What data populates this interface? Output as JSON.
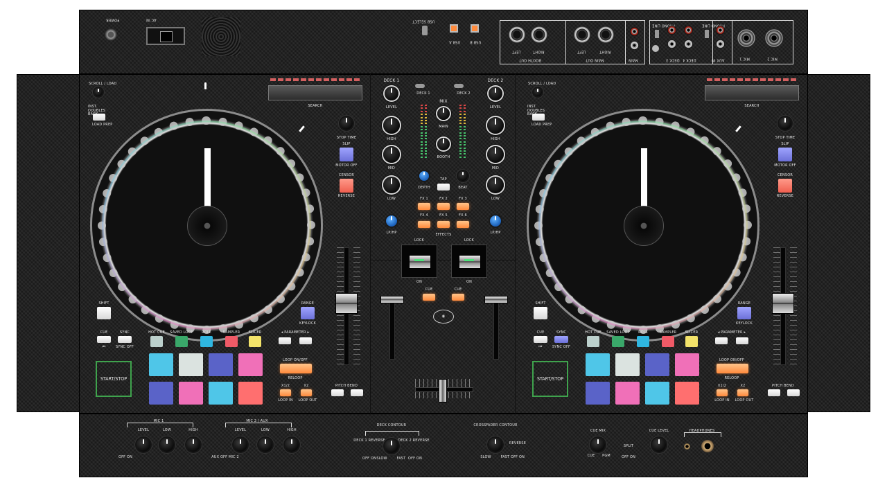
{
  "device": {
    "rear_panel": {
      "power_label": "POWER",
      "ac_label": "AC IN",
      "usb_a_label": "USB A",
      "usb_b_label": "USB B",
      "usb_switch_label": "USB SELECT",
      "booth_out_label": "BOOTH OUT",
      "main_out_label": "MAIN OUT",
      "xlr_left": "LEFT",
      "xlr_right": "RIGHT",
      "main_rca_label": "MAIN",
      "aux_in_label": "AUX IN",
      "deck3_label": "DECK 3",
      "deck4_label": "DECK 4",
      "phono_line_label": "PHONO LINE",
      "mic1_label": "MIC 1",
      "mic2_label": "MIC 2"
    },
    "deck_left": {
      "scroll_label": "SCROLL / LOAD",
      "back_label": "INST. DOUBLES BACK",
      "load_prep_label": "LOAD PREP",
      "search_label": "SEARCH",
      "stop_time_label": "STOP TIME",
      "slip_label": "SLIP",
      "motor_off_label": "MOTOR OFF",
      "censor_label": "CENSOR",
      "reverse_label": "REVERSE",
      "shift_label": "SHIFT",
      "range_label": "RANGE",
      "keylock_label": "KEYLOCK",
      "cue_label": "CUE",
      "sync_label": "SYNC",
      "sync_off_label": "SYNC OFF",
      "start_stop_label": "START/STOP",
      "mode_labels": [
        "HOT CUE",
        "SAVED LOOP",
        "ROLL",
        "SAMPLER",
        "SLICER"
      ],
      "parameter_label": "◂ PARAMETER ▸",
      "loop_on_off_label": "LOOP ON/OFF",
      "reloop_label": "RELOOP",
      "loop_half_label": "x1/2",
      "loop_double_label": "x2",
      "loop_in_label": "LOOP IN",
      "loop_out_label": "LOOP OUT",
      "pitch_bend_label": "PITCH BEND"
    },
    "deck_right": {
      "scroll_label": "SCROLL / LOAD",
      "back_label": "INST. DOUBLES BACK",
      "load_prep_label": "LOAD PREP",
      "search_label": "SEARCH",
      "stop_time_label": "STOP TIME",
      "slip_label": "SLIP",
      "motor_off_label": "MOTOR OFF",
      "censor_label": "CENSOR",
      "reverse_label": "REVERSE",
      "shift_label": "SHIFT",
      "range_label": "RANGE",
      "keylock_label": "KEYLOCK",
      "cue_label": "CUE",
      "sync_label": "SYNC",
      "sync_off_label": "SYNC OFF",
      "start_stop_label": "START/STOP",
      "mode_labels": [
        "HOT CUE",
        "SAVED LOOP",
        "ROLL",
        "SAMPLER",
        "SLICER"
      ],
      "parameter_label": "◂ PARAMETER ▸",
      "loop_on_off_label": "LOOP ON/OFF",
      "reloop_label": "RELOOP",
      "loop_half_label": "x1/2",
      "loop_double_label": "x2",
      "loop_in_label": "LOOP IN",
      "loop_out_label": "LOOP OUT",
      "pitch_bend_label": "PITCH BEND"
    },
    "mixer": {
      "deck1_label": "DECK 1",
      "deck2_label": "DECK 2",
      "deck1_switch_label": "DECK 1",
      "deck2_switch_label": "DECK 2",
      "mix_label": "MIX",
      "main_label": "MAIN",
      "booth_label": "BOOTH",
      "level_label": "LEVEL",
      "high_label": "HIGH",
      "mid_label": "MID",
      "low_label": "LOW",
      "depth_label": "DEPTH",
      "tap_label": "TAP",
      "beat_label": "BEAT",
      "fx_labels": [
        "FX 1",
        "FX 2",
        "FX 3",
        "FX 4",
        "FX 5",
        "FX 6"
      ],
      "effects_label": "EFFECTS",
      "lphp_label": "LP/HP",
      "lock_label": "LOCK",
      "on_label": "ON",
      "cue_label": "CUE"
    },
    "front_panel": {
      "mic1_label": "MIC 1",
      "mic2_aux_label": "MIC 2 / AUX",
      "level_label": "LEVEL",
      "low_label": "LOW",
      "high_label": "HIGH",
      "deck_contour_label": "DECK CONTOUR",
      "deck1_reverse_label": "DECK 1 REVERSE",
      "deck2_reverse_label": "DECK 2 REVERSE",
      "slow_label": "SLOW",
      "fast_label": "FAST",
      "crossfader_contour_label": "CROSSFADER CONTOUR",
      "reverse_label": "REVERSE",
      "cue_mix_label": "CUE MIX",
      "cue_label": "CUE",
      "pgm_label": "PGM",
      "split_label": "SPLIT",
      "cue_level_label": "CUE LEVEL",
      "headphones_label": "HEADPHONES",
      "off_on_label": "OFF ON",
      "aux_mic2_label": "AUX OFF MIC 2"
    }
  },
  "colors": {
    "orange": "#ff8a3c",
    "purple": "#6c70d8",
    "red": "#ef5e4f",
    "green_frame": "#3fa34d",
    "pad_cyan": "#4fc6e8",
    "pad_white": "#dbe3e0",
    "pad_blue": "#5a63c8",
    "pad_pink": "#f070b8",
    "pad_salmon": "#ff6f6f"
  },
  "pads": {
    "mode_colors": [
      "#bcd0cc",
      "#3aa86a",
      "#2fb6e0",
      "#f05a67",
      "#f3e36a"
    ],
    "grid_colors": [
      "#4fc6e8",
      "#dbe3e0",
      "#5a63c8",
      "#f070b8",
      "#5a63c8",
      "#f070b8",
      "#4fc6e8",
      "#ff6f6f"
    ]
  }
}
